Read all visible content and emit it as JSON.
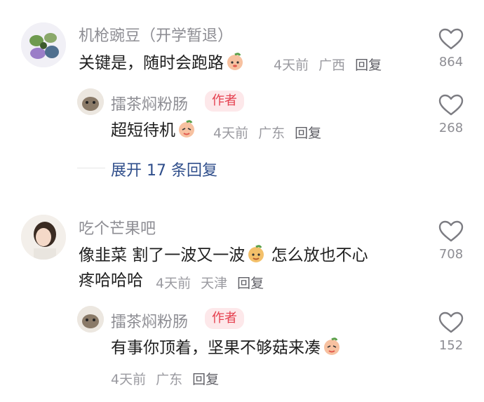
{
  "comments": [
    {
      "author": "机枪豌豆（开学暂退）",
      "text": "关键是，随时会跑路",
      "time": "4天前",
      "location": "广西",
      "reply_label": "回复",
      "likes": "864",
      "replies": [
        {
          "author": "擂茶焖粉肠",
          "badge": "作者",
          "text": "超短待机",
          "time": "4天前",
          "location": "广东",
          "reply_label": "回复",
          "likes": "268"
        }
      ],
      "expand_label": "展开 17 条回复"
    },
    {
      "author": "吃个芒果吧",
      "text_line1": "像韭菜 割了一波又一波",
      "text_line1_tail": "怎么放也不心",
      "text_line2": "疼哈哈哈",
      "time": "4天前",
      "location": "天津",
      "reply_label": "回复",
      "likes": "708",
      "replies": [
        {
          "author": "擂茶焖粉肠",
          "badge": "作者",
          "text": "有事你顶着，坚果不够菇来凑",
          "time": "4天前",
          "location": "广东",
          "reply_label": "回复",
          "likes": "152"
        }
      ]
    }
  ],
  "colors": {
    "author_badge_bg": "#fde8ea",
    "author_badge_text": "#e5404f",
    "expand_link": "#2f4e8b"
  },
  "icons": {
    "like": "heart-outline-icon",
    "emoji": "peach-face-emoji"
  }
}
